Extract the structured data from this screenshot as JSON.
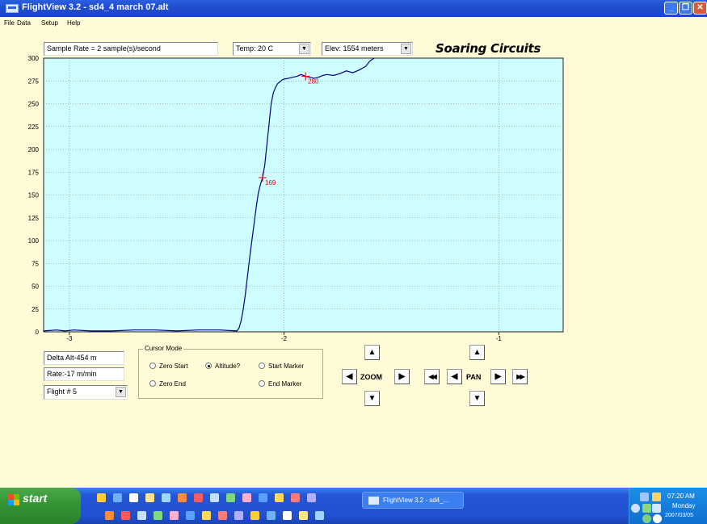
{
  "window": {
    "title": "FlightView 3.2 - sd4_4 march 07.alt"
  },
  "menu": [
    "File",
    "Data",
    "Setup",
    "Help"
  ],
  "toolbar": {
    "sample_rate": "Sample Rate = 2 sample(s)/second",
    "temp": "Temp:  20 C",
    "elev": "Elev:  1554 meters",
    "brand": "Soaring Circuits"
  },
  "chart_data": {
    "type": "line",
    "x_ticks": [
      "-3",
      "-2",
      "-1"
    ],
    "y_ticks": [
      "0",
      "25",
      "50",
      "75",
      "100",
      "125",
      "150",
      "175",
      "200",
      "225",
      "250",
      "275",
      "300"
    ],
    "xlim": [
      -3.12,
      -0.7
    ],
    "ylim": [
      0,
      300
    ],
    "grid": true,
    "background": "#cdfdff",
    "line_color": "#000080",
    "series": [
      {
        "x": [
          -3.12,
          -3.06,
          -3.02,
          -2.98,
          -2.9,
          -2.8,
          -2.7,
          -2.6,
          -2.5,
          -2.4,
          -2.3,
          -2.22,
          -2.21,
          -2.2,
          -2.19,
          -2.18,
          -2.17,
          -2.16,
          -2.15,
          -2.14,
          -2.13,
          -2.12,
          -2.11,
          -2.1,
          -2.09,
          -2.08,
          -2.07,
          -2.06,
          -2.05,
          -2.04,
          -2.03,
          -2.02,
          -2.01,
          -2.0,
          -1.98,
          -1.96,
          -1.94,
          -1.92,
          -1.9,
          -1.88,
          -1.86,
          -1.84,
          -1.82,
          -1.8,
          -1.77,
          -1.74,
          -1.71,
          -1.68,
          -1.65,
          -1.62,
          -1.6,
          -1.58
        ],
        "y": [
          1,
          2,
          1,
          2,
          1,
          1,
          2,
          2,
          1,
          2,
          2,
          1,
          4,
          12,
          25,
          42,
          62,
          82,
          100,
          118,
          136,
          152,
          162,
          169,
          183,
          205,
          228,
          250,
          262,
          268,
          272,
          274,
          276,
          277,
          278,
          279,
          280,
          282,
          280,
          279,
          278,
          279,
          281,
          282,
          281,
          283,
          286,
          284,
          287,
          291,
          297,
          300
        ]
      }
    ],
    "markers": [
      {
        "x": -2.1,
        "y": 169,
        "label": "169"
      },
      {
        "x": -1.9,
        "y": 280,
        "label": "280"
      }
    ]
  },
  "stats": {
    "delta_alt": "Delta Alt-454 m",
    "rate": "Rate:-17 m/min",
    "flight": "Flight # 5"
  },
  "cursor_mode": {
    "title": "Cursor Mode",
    "zero_start": "Zero Start",
    "altitude": "Altitude?",
    "start_marker": "Start Marker",
    "zero_end": "Zero End",
    "end_marker": "End Marker",
    "selected": "altitude"
  },
  "nav": {
    "zoom": "ZOOM",
    "pan": "PAN",
    "up": "▲",
    "down": "▼",
    "left": "◀",
    "right": "▶",
    "fast_left": "◀◀",
    "fast_right": "▶▶"
  },
  "taskbar": {
    "start": "start",
    "task": "FlightView 3.2 - sd4_...",
    "time": "07:20 AM",
    "day": "Monday",
    "date": "2007/03/05"
  }
}
